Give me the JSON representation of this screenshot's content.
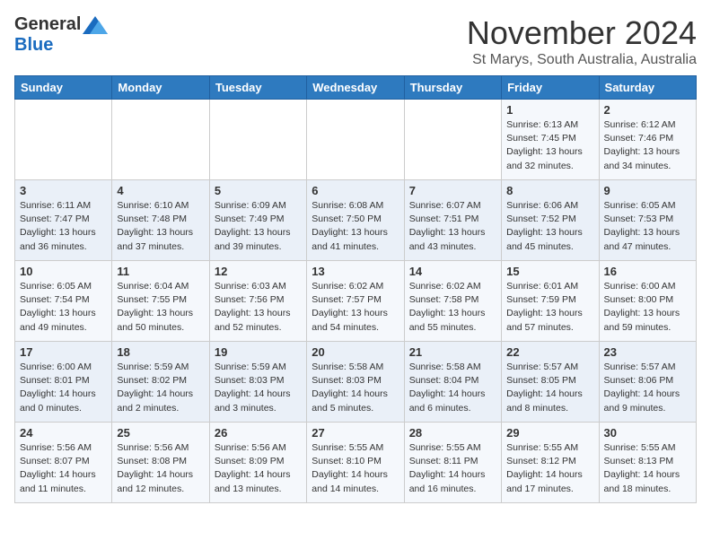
{
  "header": {
    "logo_general": "General",
    "logo_blue": "Blue",
    "month_title": "November 2024",
    "subtitle": "St Marys, South Australia, Australia"
  },
  "calendar": {
    "days_of_week": [
      "Sunday",
      "Monday",
      "Tuesday",
      "Wednesday",
      "Thursday",
      "Friday",
      "Saturday"
    ],
    "weeks": [
      [
        {
          "day": "",
          "info": ""
        },
        {
          "day": "",
          "info": ""
        },
        {
          "day": "",
          "info": ""
        },
        {
          "day": "",
          "info": ""
        },
        {
          "day": "",
          "info": ""
        },
        {
          "day": "1",
          "info": "Sunrise: 6:13 AM\nSunset: 7:45 PM\nDaylight: 13 hours\nand 32 minutes."
        },
        {
          "day": "2",
          "info": "Sunrise: 6:12 AM\nSunset: 7:46 PM\nDaylight: 13 hours\nand 34 minutes."
        }
      ],
      [
        {
          "day": "3",
          "info": "Sunrise: 6:11 AM\nSunset: 7:47 PM\nDaylight: 13 hours\nand 36 minutes."
        },
        {
          "day": "4",
          "info": "Sunrise: 6:10 AM\nSunset: 7:48 PM\nDaylight: 13 hours\nand 37 minutes."
        },
        {
          "day": "5",
          "info": "Sunrise: 6:09 AM\nSunset: 7:49 PM\nDaylight: 13 hours\nand 39 minutes."
        },
        {
          "day": "6",
          "info": "Sunrise: 6:08 AM\nSunset: 7:50 PM\nDaylight: 13 hours\nand 41 minutes."
        },
        {
          "day": "7",
          "info": "Sunrise: 6:07 AM\nSunset: 7:51 PM\nDaylight: 13 hours\nand 43 minutes."
        },
        {
          "day": "8",
          "info": "Sunrise: 6:06 AM\nSunset: 7:52 PM\nDaylight: 13 hours\nand 45 minutes."
        },
        {
          "day": "9",
          "info": "Sunrise: 6:05 AM\nSunset: 7:53 PM\nDaylight: 13 hours\nand 47 minutes."
        }
      ],
      [
        {
          "day": "10",
          "info": "Sunrise: 6:05 AM\nSunset: 7:54 PM\nDaylight: 13 hours\nand 49 minutes."
        },
        {
          "day": "11",
          "info": "Sunrise: 6:04 AM\nSunset: 7:55 PM\nDaylight: 13 hours\nand 50 minutes."
        },
        {
          "day": "12",
          "info": "Sunrise: 6:03 AM\nSunset: 7:56 PM\nDaylight: 13 hours\nand 52 minutes."
        },
        {
          "day": "13",
          "info": "Sunrise: 6:02 AM\nSunset: 7:57 PM\nDaylight: 13 hours\nand 54 minutes."
        },
        {
          "day": "14",
          "info": "Sunrise: 6:02 AM\nSunset: 7:58 PM\nDaylight: 13 hours\nand 55 minutes."
        },
        {
          "day": "15",
          "info": "Sunrise: 6:01 AM\nSunset: 7:59 PM\nDaylight: 13 hours\nand 57 minutes."
        },
        {
          "day": "16",
          "info": "Sunrise: 6:00 AM\nSunset: 8:00 PM\nDaylight: 13 hours\nand 59 minutes."
        }
      ],
      [
        {
          "day": "17",
          "info": "Sunrise: 6:00 AM\nSunset: 8:01 PM\nDaylight: 14 hours\nand 0 minutes."
        },
        {
          "day": "18",
          "info": "Sunrise: 5:59 AM\nSunset: 8:02 PM\nDaylight: 14 hours\nand 2 minutes."
        },
        {
          "day": "19",
          "info": "Sunrise: 5:59 AM\nSunset: 8:03 PM\nDaylight: 14 hours\nand 3 minutes."
        },
        {
          "day": "20",
          "info": "Sunrise: 5:58 AM\nSunset: 8:03 PM\nDaylight: 14 hours\nand 5 minutes."
        },
        {
          "day": "21",
          "info": "Sunrise: 5:58 AM\nSunset: 8:04 PM\nDaylight: 14 hours\nand 6 minutes."
        },
        {
          "day": "22",
          "info": "Sunrise: 5:57 AM\nSunset: 8:05 PM\nDaylight: 14 hours\nand 8 minutes."
        },
        {
          "day": "23",
          "info": "Sunrise: 5:57 AM\nSunset: 8:06 PM\nDaylight: 14 hours\nand 9 minutes."
        }
      ],
      [
        {
          "day": "24",
          "info": "Sunrise: 5:56 AM\nSunset: 8:07 PM\nDaylight: 14 hours\nand 11 minutes."
        },
        {
          "day": "25",
          "info": "Sunrise: 5:56 AM\nSunset: 8:08 PM\nDaylight: 14 hours\nand 12 minutes."
        },
        {
          "day": "26",
          "info": "Sunrise: 5:56 AM\nSunset: 8:09 PM\nDaylight: 14 hours\nand 13 minutes."
        },
        {
          "day": "27",
          "info": "Sunrise: 5:55 AM\nSunset: 8:10 PM\nDaylight: 14 hours\nand 14 minutes."
        },
        {
          "day": "28",
          "info": "Sunrise: 5:55 AM\nSunset: 8:11 PM\nDaylight: 14 hours\nand 16 minutes."
        },
        {
          "day": "29",
          "info": "Sunrise: 5:55 AM\nSunset: 8:12 PM\nDaylight: 14 hours\nand 17 minutes."
        },
        {
          "day": "30",
          "info": "Sunrise: 5:55 AM\nSunset: 8:13 PM\nDaylight: 14 hours\nand 18 minutes."
        }
      ]
    ]
  }
}
